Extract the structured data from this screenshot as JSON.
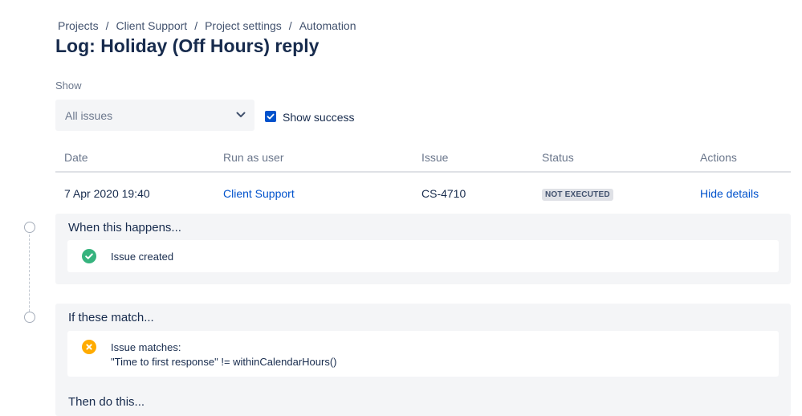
{
  "breadcrumb": {
    "items": [
      "Projects",
      "Client Support",
      "Project settings",
      "Automation"
    ],
    "separator": "/"
  },
  "page_title": "Log: Holiday (Off Hours) reply",
  "filter": {
    "show_label": "Show",
    "select_value": "All issues",
    "show_success_label": "Show success",
    "show_success_checked": true
  },
  "table": {
    "headers": {
      "date": "Date",
      "run_as": "Run as user",
      "issue": "Issue",
      "status": "Status",
      "actions": "Actions"
    },
    "row": {
      "date": "7 Apr 2020 19:40",
      "run_as": "Client Support",
      "issue": "CS-4710",
      "status": "NOT EXECUTED",
      "action": "Hide details"
    }
  },
  "details": {
    "trigger": {
      "title": "When this happens...",
      "item": "Issue created",
      "icon": "success-check-icon"
    },
    "condition": {
      "title": "If these match...",
      "item_line1": "Issue matches:",
      "item_line2": "\"Time to first response\" != withinCalendarHours()",
      "icon": "failure-x-icon"
    },
    "action": {
      "title": "Then do this..."
    }
  },
  "colors": {
    "link": "#0052cc",
    "success": "#36b37e",
    "warning": "#ffab00",
    "panel_bg": "#f4f5f7"
  }
}
